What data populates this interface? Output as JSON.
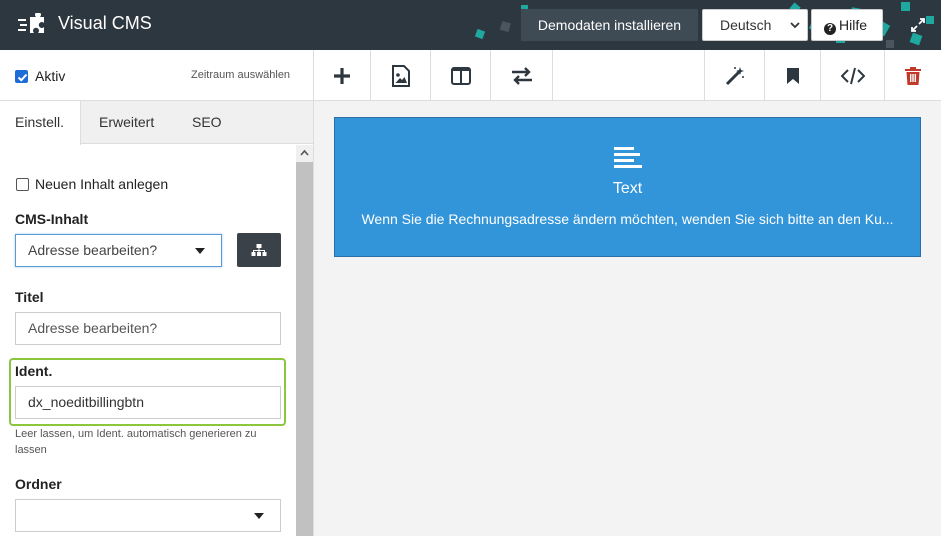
{
  "header": {
    "title": "Visual CMS",
    "demo_button": "Demodaten installieren",
    "language": "Deutsch",
    "help_button": "Hilfe",
    "bg_color": "#2d3740",
    "puzzle_color": "#1fa8a0"
  },
  "left": {
    "active_label": "Aktiv",
    "active_checked": true,
    "zeitraum_link": "Zeitraum auswählen",
    "tabs": [
      {
        "label": "Einstell.",
        "active": true
      },
      {
        "label": "Erweitert",
        "active": false
      },
      {
        "label": "SEO",
        "active": false
      }
    ],
    "form": {
      "new_content_label": "Neuen Inhalt anlegen",
      "new_content_checked": false,
      "cms_content_label": "CMS-Inhalt",
      "cms_content_value": "Adresse bearbeiten?",
      "title_label": "Titel",
      "title_placeholder": "Adresse bearbeiten?",
      "ident_label": "Ident.",
      "ident_value": "dx_noeditbillingbtn",
      "ident_help": "Leer lassen, um Ident. automatisch generieren zu lassen",
      "folder_label": "Ordner",
      "folder_value": ""
    }
  },
  "toolbar": {
    "buttons": [
      "plus-icon",
      "image-icon",
      "columns-icon",
      "swap-icon",
      "magic-wand-icon",
      "bookmark-icon",
      "code-icon",
      "trash-icon"
    ],
    "trash_color": "#c0392b"
  },
  "canvas": {
    "block": {
      "title": "Text",
      "text": "Wenn Sie die Rechnungsadresse ändern möchten, wenden Sie sich bitte an den Ku...",
      "color": "#3295da"
    }
  }
}
